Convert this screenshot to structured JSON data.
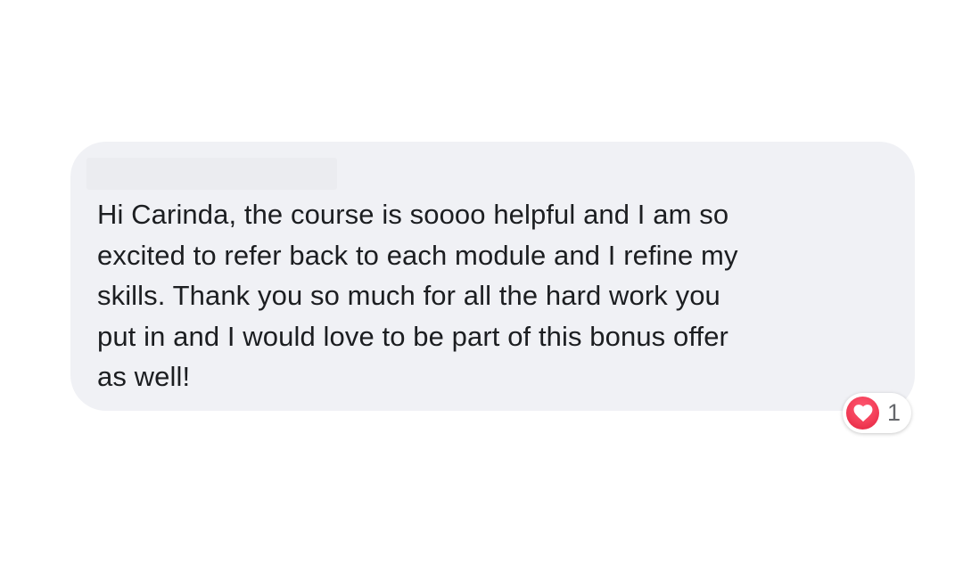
{
  "comment": {
    "author": "",
    "text": "Hi Carinda, the course is soooo helpful and I am so\nexcited to refer back to each module and I refine my\nskills. Thank you so much for all the hard work you\nput in and I would love to be part of this bonus offer\nas well!"
  },
  "reactions": {
    "icon": "heart-icon",
    "count": "1",
    "color": "#f33e58"
  },
  "colors": {
    "bubble_background": "#f0f1f5",
    "text": "#1c1e21",
    "count_text": "#65676b"
  }
}
